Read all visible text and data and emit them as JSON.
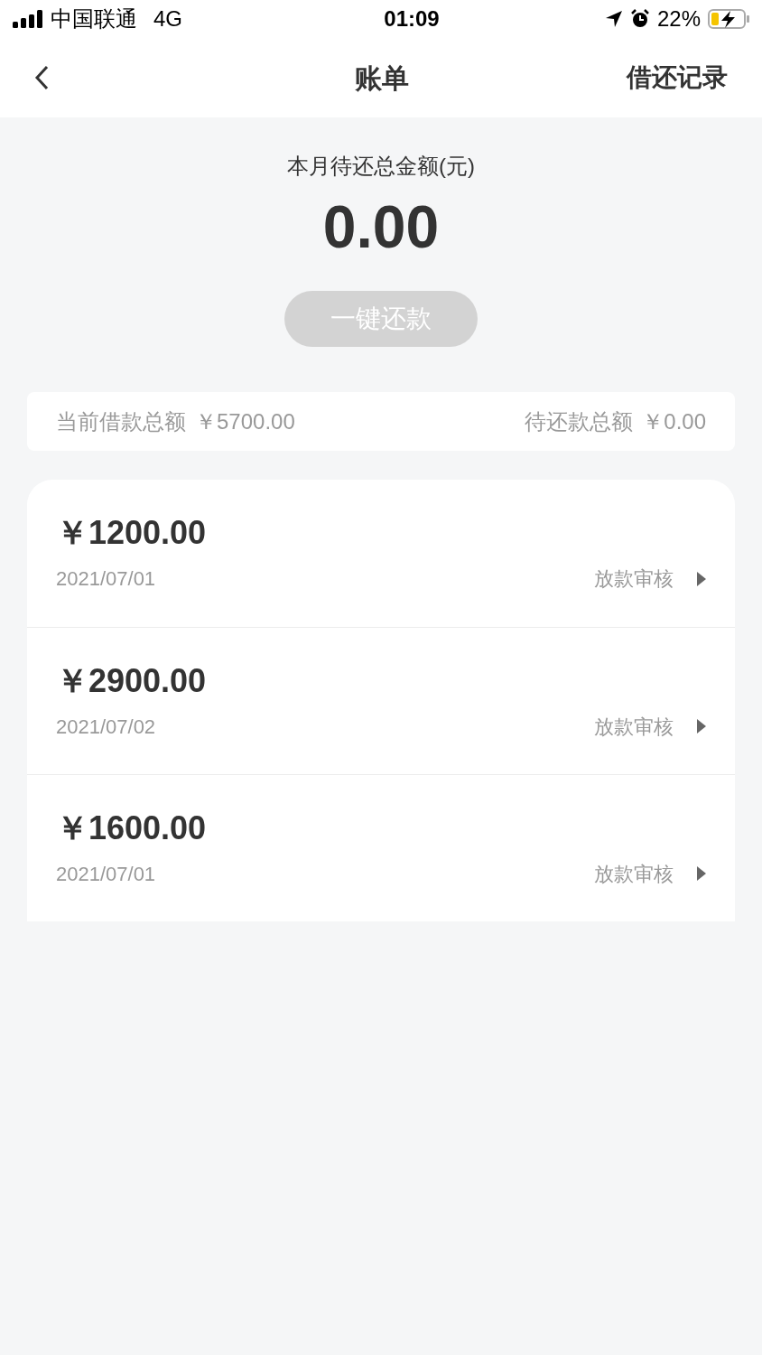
{
  "status_bar": {
    "carrier": "中国联通",
    "network": "4G",
    "time": "01:09",
    "battery": "22%"
  },
  "nav": {
    "title": "账单",
    "action": "借还记录"
  },
  "due": {
    "label": "本月待还总金额(元)",
    "amount": "0.00",
    "button": {
      "label": "一键还款",
      "disabled": true
    }
  },
  "summary": [
    {
      "label": "当前借款总额",
      "value": "￥5700.00"
    },
    {
      "label": "待还款总额",
      "value": "￥0.00"
    }
  ],
  "bills": [
    {
      "amount": "￥1200.00",
      "date": "2021/07/01",
      "status": "放款审核"
    },
    {
      "amount": "￥2900.00",
      "date": "2021/07/02",
      "status": "放款审核"
    },
    {
      "amount": "￥1600.00",
      "date": "2021/07/01",
      "status": "放款审核"
    }
  ]
}
